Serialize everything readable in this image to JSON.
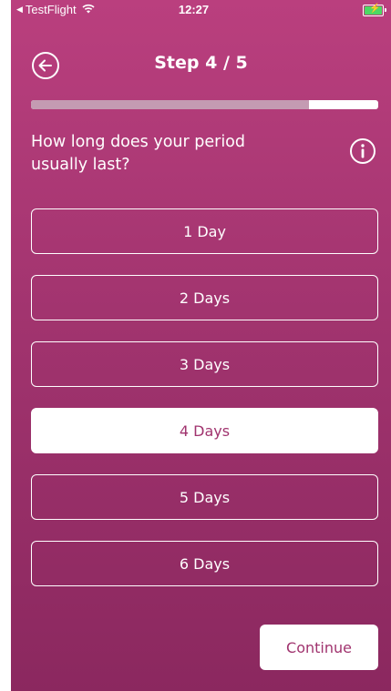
{
  "status_bar": {
    "back_app": "TestFlight",
    "time": "12:27"
  },
  "header": {
    "title": "Step 4 / 5"
  },
  "progress": {
    "fraction": 0.8
  },
  "question": {
    "text": "How long does your period usually last?"
  },
  "options": [
    {
      "label": "1 Day",
      "selected": false
    },
    {
      "label": "2 Days",
      "selected": false
    },
    {
      "label": "3 Days",
      "selected": false
    },
    {
      "label": "4 Days",
      "selected": true
    },
    {
      "label": "5 Days",
      "selected": false
    },
    {
      "label": "6 Days",
      "selected": false
    }
  ],
  "footer": {
    "continue_label": "Continue"
  },
  "colors": {
    "background_top": "#ba3f7e",
    "background_bottom": "#8b285f",
    "accent": "#a0336e",
    "progress_fill": "#c49bb2",
    "battery": "#4cd964"
  },
  "icons": {
    "back": "arrow-left-circle-icon",
    "info": "info-circle-icon",
    "wifi": "wifi-icon",
    "battery": "battery-charging-icon"
  }
}
